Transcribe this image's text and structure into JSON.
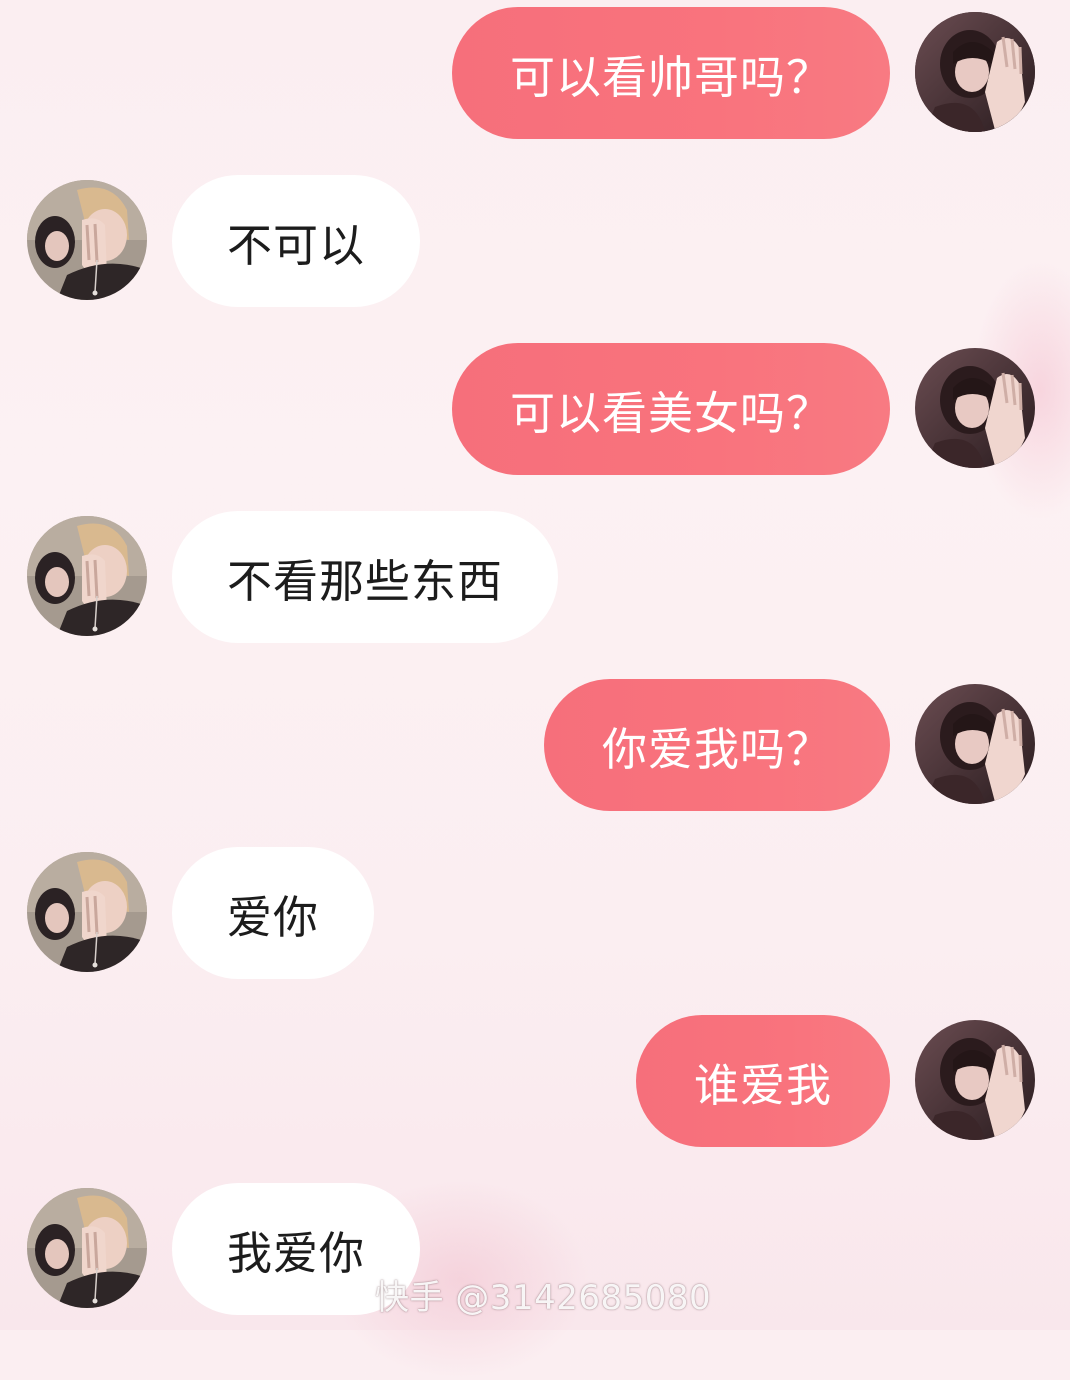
{
  "messages": [
    {
      "side": "out",
      "text": "可以看帅哥吗？"
    },
    {
      "side": "in",
      "text": "不可以"
    },
    {
      "side": "out",
      "text": "可以看美女吗？"
    },
    {
      "side": "in",
      "text": "不看那些东西"
    },
    {
      "side": "out",
      "text": "你爱我吗？"
    },
    {
      "side": "in",
      "text": "爱你"
    },
    {
      "side": "out",
      "text": "谁爱我"
    },
    {
      "side": "in",
      "text": "我爱你"
    }
  ],
  "watermark": "快手 @3142685080",
  "colors": {
    "outgoing_bubble": "#f8737d",
    "incoming_bubble": "#ffffff",
    "background": "#fcf0f3"
  },
  "icons": {
    "outgoing_avatar": "girl-avatar-icon",
    "incoming_avatar": "boy-avatar-icon"
  }
}
